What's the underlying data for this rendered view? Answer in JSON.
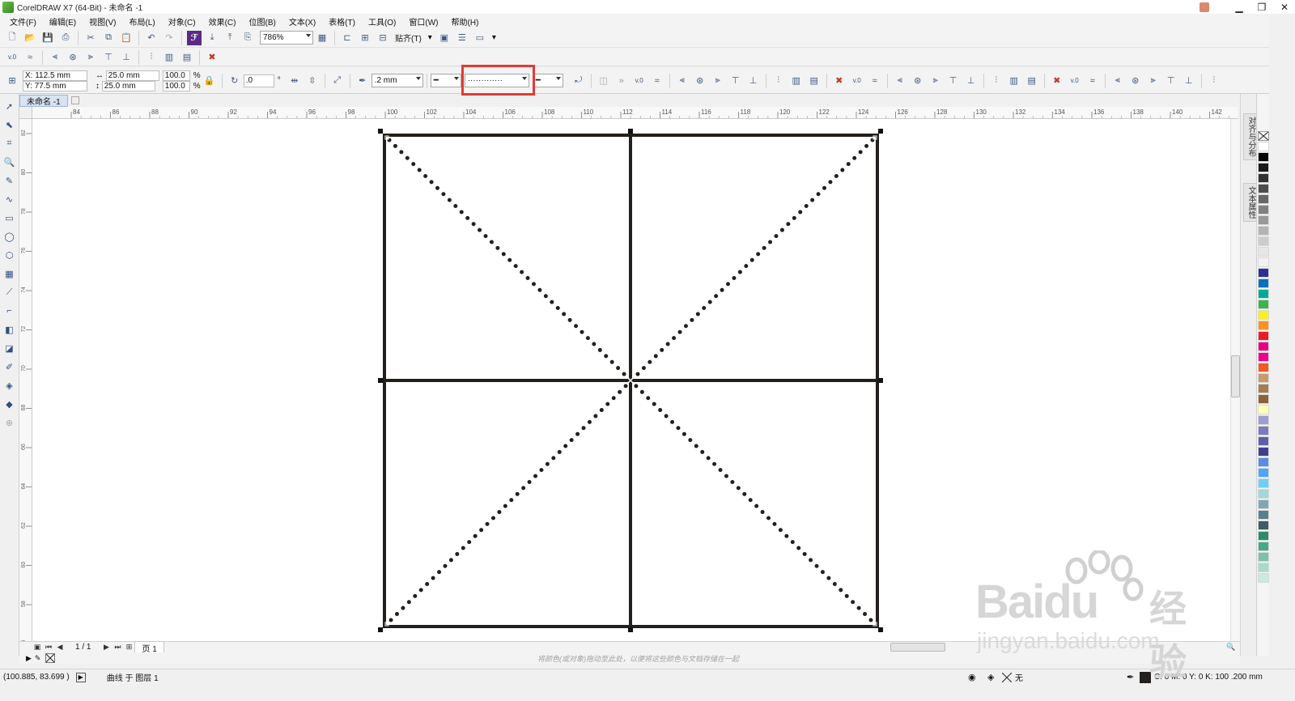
{
  "window": {
    "title": "CorelDRAW X7 (64-Bit) - 未命名 -1"
  },
  "menu": [
    "文件(F)",
    "编辑(E)",
    "视图(V)",
    "布局(L)",
    "对象(C)",
    "效果(C)",
    "位图(B)",
    "文本(X)",
    "表格(T)",
    "工具(O)",
    "窗口(W)",
    "帮助(H)"
  ],
  "toolbar": {
    "zoom": "786%",
    "snap_label": "贴齐(T)"
  },
  "properties": {
    "x": "X: 112.5 mm",
    "y": "Y: 77.5 mm",
    "width": "25.0 mm",
    "height": "25.0 mm",
    "scale_w": "100.0",
    "scale_h": "100.0",
    "pct": "%",
    "rotation": ".0",
    "degree": "°",
    "outline_width": ".2 mm",
    "line_style": "·············"
  },
  "document_tab": "未命名 -1",
  "ruler": {
    "h_labels": [
      "84",
      "86",
      "88",
      "90",
      "92",
      "94",
      "96",
      "98",
      "100",
      "102",
      "104",
      "106",
      "108",
      "110",
      "112",
      "114",
      "116",
      "118",
      "120",
      "122",
      "124",
      "126",
      "128",
      "130",
      "132",
      "134",
      "136",
      "138",
      "140",
      "142"
    ],
    "v_labels": [
      "82",
      "80",
      "78",
      "76",
      "74",
      "72",
      "70",
      "68",
      "66",
      "64",
      "62",
      "60",
      "58",
      "56"
    ]
  },
  "page_nav": {
    "count": "1 / 1",
    "tab": "页 1"
  },
  "hint": "将颜色(或对象)拖动至此处，以便将这些颜色与文档存储在一起",
  "status": {
    "coords": "(100.885, 83.699 )",
    "object": "曲线 于 图层 1",
    "fill_none": "无",
    "outline": "C: 0 M: 0 Y: 0 K: 100  .200 mm"
  },
  "dockers": [
    "对齐与分布",
    "文本属性"
  ],
  "palette": [
    "#ffffff",
    "#000000",
    "#1a1a1a",
    "#333333",
    "#4d4d4d",
    "#666666",
    "#808080",
    "#999999",
    "#b3b3b3",
    "#cccccc",
    "#e6e6e6",
    "#f2f2f2",
    "#2e3192",
    "#0071bc",
    "#00a99d",
    "#39b54a",
    "#fcee21",
    "#f7931e",
    "#ed1c24",
    "#e6007e",
    "#ec008c",
    "#f15a24",
    "#c69c6d",
    "#a67c52",
    "#8c6239",
    "#ffffb3",
    "#9e9ecf",
    "#7b7bbf",
    "#5f5faa",
    "#3f3f8f",
    "#5c8ae6",
    "#4da6ff",
    "#6ecff6",
    "#9ed8db",
    "#7fa8b3",
    "#5a7f8c",
    "#3d5c66",
    "#2a8c6a",
    "#46a88a",
    "#7ac2a8",
    "#a9dbc9",
    "#cde8df"
  ],
  "watermark": {
    "brand": "Bai",
    "brand2": "du",
    "cn": "经验",
    "url": "jingyan.baidu.com"
  }
}
